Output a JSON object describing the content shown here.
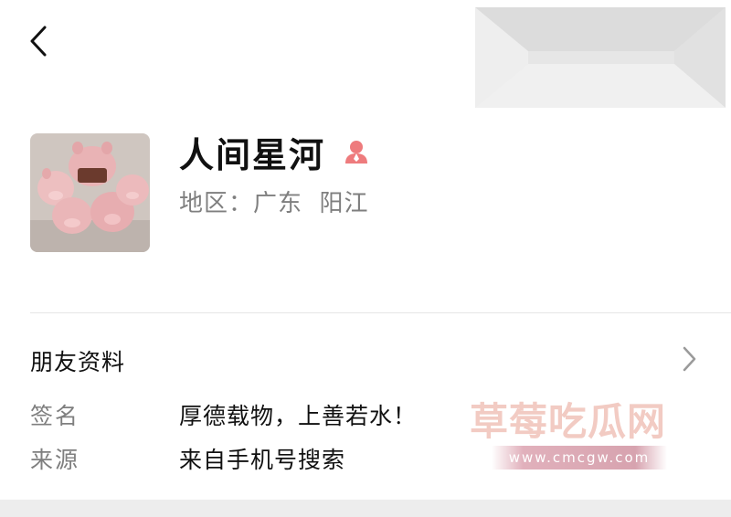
{
  "profile": {
    "nickname": "人间星河",
    "region": "地区：广东  阳江"
  },
  "friend_info": {
    "section_title": "朋友资料",
    "fields": [
      {
        "label": "签名",
        "value": "厚德载物，上善若水！"
      },
      {
        "label": "来源",
        "value": "来自手机号搜索"
      }
    ]
  },
  "watermark": {
    "text": "草莓吃瓜网",
    "url": "www.cmcgw.com"
  },
  "colors": {
    "gender_icon": "#ee7b7d",
    "secondary_text": "#7f7f7f",
    "divider": "#e6e6e6",
    "watermark": "#f1c6bd"
  },
  "icons": {
    "back": "chevron-left-icon",
    "gender": "female-icon",
    "section_arrow": "chevron-right-icon"
  }
}
